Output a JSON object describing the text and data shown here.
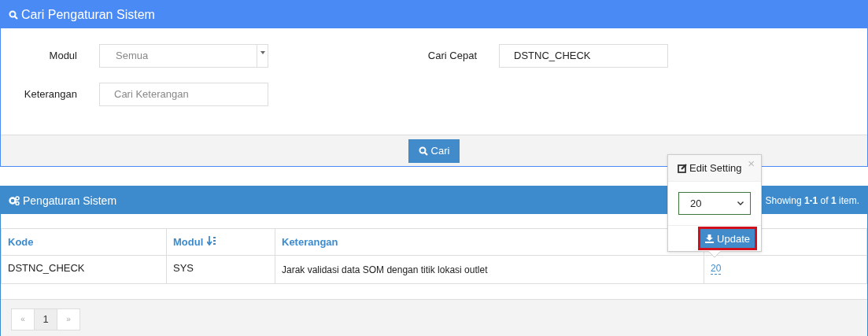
{
  "search_panel": {
    "title": "Cari Pengaturan Sistem",
    "fields": [
      {
        "kind": "select",
        "label": "Modul",
        "placeholder": "Semua"
      },
      {
        "kind": "text",
        "label": "Cari Cepat",
        "value": "DSTNC_CHECK"
      },
      {
        "kind": "text",
        "label": "Keterangan",
        "placeholder": "Cari Keterangan"
      }
    ],
    "button": "Cari"
  },
  "results_panel": {
    "title": "Pengaturan Sistem",
    "summary": "Showing **1-1** of **1** item.",
    "table": {
      "columns": [
        {
          "label": "Kode",
          "sortable": false
        },
        {
          "label": "Modul",
          "sortable": true
        },
        {
          "label": "Keterangan",
          "sortable": false
        }
      ],
      "rows": [
        {
          "cells": [
            "DSTNC_CHECK",
            "SYS",
            "Jarak validasi data SOM dengan titik lokasi outlet"
          ],
          "value": "20"
        }
      ]
    },
    "pagination": [
      {
        "label": "«",
        "selected": false,
        "disabled": true
      },
      {
        "label": "1",
        "selected": true,
        "disabled": false
      },
      {
        "label": "»",
        "selected": false,
        "disabled": true
      }
    ]
  },
  "popover": {
    "title": "Edit Setting",
    "close": "×",
    "value": "20",
    "button": "Update",
    "highlighted": true
  }
}
